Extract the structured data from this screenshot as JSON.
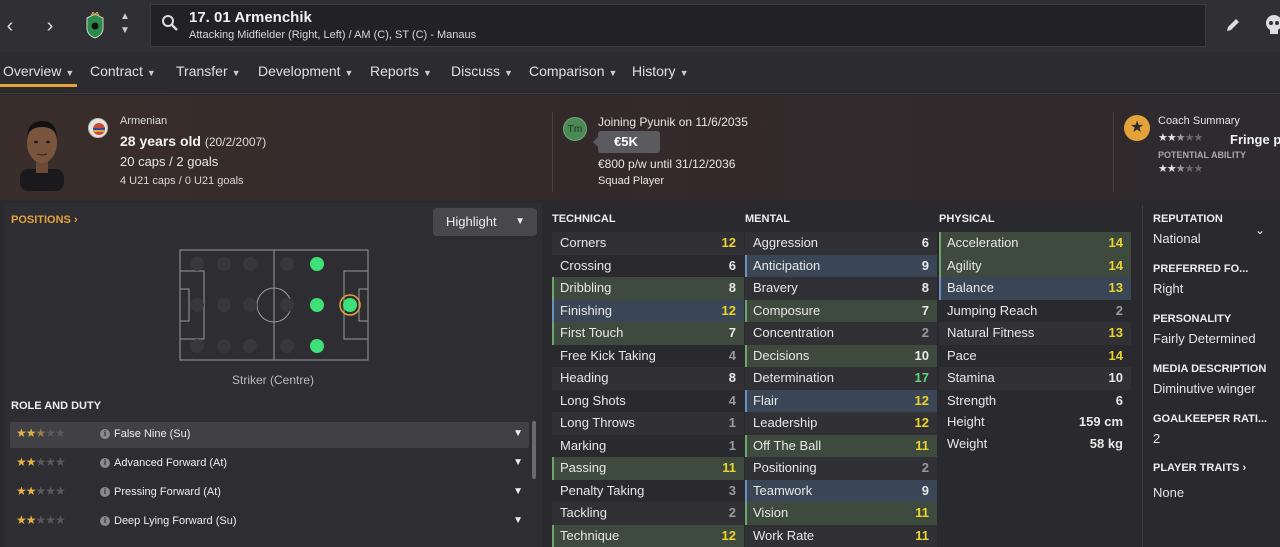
{
  "header": {
    "player_title": "17. 01 Armenchik",
    "player_subtitle": "Attacking Midfielder (Right, Left) / AM (C), ST (C) - Manaus"
  },
  "tabs": [
    {
      "label": "Overview"
    },
    {
      "label": "Contract"
    },
    {
      "label": "Transfer"
    },
    {
      "label": "Development"
    },
    {
      "label": "Reports"
    },
    {
      "label": "Discuss"
    },
    {
      "label": "Comparison"
    },
    {
      "label": "History"
    }
  ],
  "profile": {
    "nationality": "Armenian",
    "age": "28 years old",
    "dob": "(20/2/2007)",
    "caps": "20 caps / 2 goals",
    "u21caps": "4 U21 caps / 0 U21 goals"
  },
  "transfer": {
    "badge": "Tm",
    "joining": "Joining Pyunik on 11/6/2035",
    "fee": "€5K",
    "wage": "€800 p/w until 31/12/2036",
    "status": "Squad Player"
  },
  "coach": {
    "label": "Coach Summary",
    "current_ability_stars": 2.5,
    "verdict": "Fringe p",
    "potential_label": "POTENTIAL ABILITY",
    "potential_ability_stars": 2.5
  },
  "positions": {
    "title": "POSITIONS",
    "highlight_label": "Highlight",
    "position_label": "Striker (Centre)"
  },
  "roles": {
    "title": "ROLE AND DUTY",
    "items": [
      {
        "name": "False Nine (Su)",
        "stars": 2.5
      },
      {
        "name": "Advanced Forward (At)",
        "stars": 2
      },
      {
        "name": "Pressing Forward (At)",
        "stars": 2
      },
      {
        "name": "Deep Lying Forward (Su)",
        "stars": 2
      }
    ]
  },
  "technical": {
    "title": "TECHNICAL",
    "items": [
      {
        "name": "Corners",
        "value": "12"
      },
      {
        "name": "Crossing",
        "value": "6"
      },
      {
        "name": "Dribbling",
        "value": "8"
      },
      {
        "name": "Finishing",
        "value": "12"
      },
      {
        "name": "First Touch",
        "value": "7"
      },
      {
        "name": "Free Kick Taking",
        "value": "4"
      },
      {
        "name": "Heading",
        "value": "8"
      },
      {
        "name": "Long Shots",
        "value": "4"
      },
      {
        "name": "Long Throws",
        "value": "1"
      },
      {
        "name": "Marking",
        "value": "1"
      },
      {
        "name": "Passing",
        "value": "11"
      },
      {
        "name": "Penalty Taking",
        "value": "3"
      },
      {
        "name": "Tackling",
        "value": "2"
      },
      {
        "name": "Technique",
        "value": "12"
      }
    ]
  },
  "mental": {
    "title": "MENTAL",
    "items": [
      {
        "name": "Aggression",
        "value": "6"
      },
      {
        "name": "Anticipation",
        "value": "9"
      },
      {
        "name": "Bravery",
        "value": "8"
      },
      {
        "name": "Composure",
        "value": "7"
      },
      {
        "name": "Concentration",
        "value": "2"
      },
      {
        "name": "Decisions",
        "value": "10"
      },
      {
        "name": "Determination",
        "value": "17"
      },
      {
        "name": "Flair",
        "value": "12"
      },
      {
        "name": "Leadership",
        "value": "12"
      },
      {
        "name": "Off The Ball",
        "value": "11"
      },
      {
        "name": "Positioning",
        "value": "2"
      },
      {
        "name": "Teamwork",
        "value": "9"
      },
      {
        "name": "Vision",
        "value": "11"
      },
      {
        "name": "Work Rate",
        "value": "11"
      }
    ]
  },
  "physical": {
    "title": "PHYSICAL",
    "items": [
      {
        "name": "Acceleration",
        "value": "14"
      },
      {
        "name": "Agility",
        "value": "14"
      },
      {
        "name": "Balance",
        "value": "13"
      },
      {
        "name": "Jumping Reach",
        "value": "2"
      },
      {
        "name": "Natural Fitness",
        "value": "13"
      },
      {
        "name": "Pace",
        "value": "14"
      },
      {
        "name": "Stamina",
        "value": "10"
      },
      {
        "name": "Strength",
        "value": "6"
      }
    ],
    "height_label": "Height",
    "height_value": "159 cm",
    "weight_label": "Weight",
    "weight_value": "58 kg"
  },
  "info": {
    "reputation_label": "REPUTATION",
    "reputation_value": "National",
    "foot_label": "PREFERRED FO...",
    "foot_value": "Right",
    "personality_label": "PERSONALITY",
    "personality_value": "Fairly Determined",
    "media_label": "MEDIA DESCRIPTION",
    "media_value": "Diminutive winger",
    "gk_label": "GOALKEEPER RATI...",
    "gk_value": "2",
    "traits_label": "PLAYER TRAITS",
    "traits_value": "None"
  },
  "colors": {
    "accent": "#e3a33a",
    "attr_yellow": "#ecd32a",
    "attr_green": "#5fd47a",
    "highlight_green": "#3e4a3e",
    "highlight_blue": "#3a4656"
  }
}
